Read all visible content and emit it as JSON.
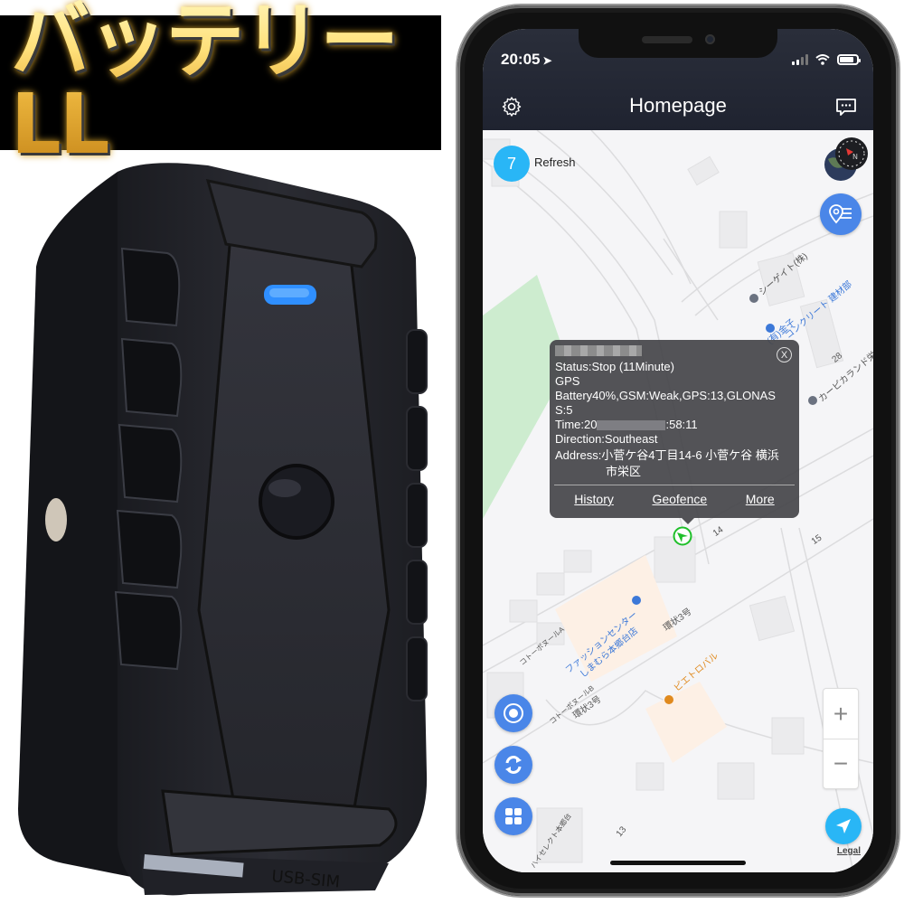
{
  "banner": {
    "text": "バッテリーLL"
  },
  "device": {
    "port_label": "USB-SIM",
    "led_color": "#2f8fff"
  },
  "phone": {
    "status_bar": {
      "time": "20:05",
      "signal_bars": 2,
      "signal_total": 4,
      "battery_level": 0.85
    },
    "nav": {
      "title": "Homepage",
      "left_icon": "gear-icon",
      "right_icon": "chat-icon"
    },
    "map": {
      "refresh_count": "7",
      "refresh_label": "Refresh",
      "popup": {
        "status": "Status:Stop (11Minute)",
        "mode": "GPS",
        "battery_line": "Battery40%,GSM:Weak,GPS:13,GLONAS",
        "battery_line_cont": "S:5",
        "time_prefix": "Time:20",
        "time_suffix": ":58:11",
        "direction": "Direction:Southeast",
        "address": "Address:小菅ケ谷4丁目14-6 小菅ケ谷 横浜",
        "address_cont": "市栄区",
        "actions": [
          "History",
          "Geofence",
          "More"
        ],
        "close": "X"
      },
      "labels": {
        "sea_gate": "シーゲイト(株)",
        "kaneko": "(有)金子",
        "concrete": "コンクリート 建材部",
        "carpi": "カーピカランド栄店",
        "fashion": "ファッションセンター",
        "shimamura": "しまむら本郷台店",
        "pietro": "ピエトロバル",
        "court_a": "コトーボヌールA",
        "court_b": "コトーボヌールB",
        "road": "環状3号",
        "road2": "環状3号",
        "num_14": "14",
        "num_15": "15",
        "num_28": "28",
        "num_13": "13",
        "haisely": "ハイセレクト本郷台"
      },
      "zoom_in": "+",
      "zoom_out": "−",
      "legal": "Legal"
    }
  }
}
